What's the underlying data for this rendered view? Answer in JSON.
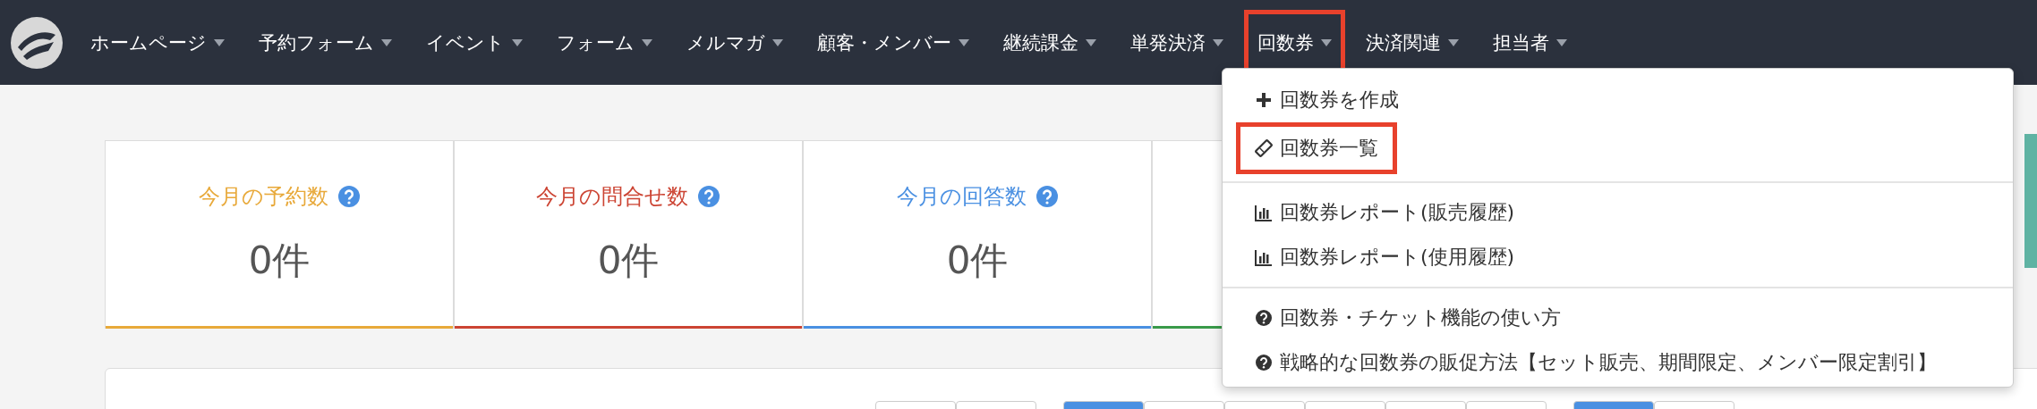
{
  "navbar": {
    "items": [
      {
        "label": "ホームページ",
        "highlighted": false
      },
      {
        "label": "予約フォーム",
        "highlighted": false
      },
      {
        "label": "イベント",
        "highlighted": false
      },
      {
        "label": "フォーム",
        "highlighted": false
      },
      {
        "label": "メルマガ",
        "highlighted": false
      },
      {
        "label": "顧客・メンバー",
        "highlighted": false
      },
      {
        "label": "継続課金",
        "highlighted": false
      },
      {
        "label": "単発決済",
        "highlighted": false
      },
      {
        "label": "回数券",
        "highlighted": true
      },
      {
        "label": "決済関連",
        "highlighted": false
      },
      {
        "label": "担当者",
        "highlighted": false
      }
    ]
  },
  "dropdown": {
    "groups": [
      [
        {
          "kind": "create",
          "label": "回数券を作成",
          "highlighted": false
        },
        {
          "kind": "list",
          "label": "回数券一覧",
          "highlighted": true
        }
      ],
      [
        {
          "kind": "report",
          "label": "回数券レポート(販売履歴)",
          "highlighted": false
        },
        {
          "kind": "report",
          "label": "回数券レポート(使用履歴)",
          "highlighted": false
        }
      ],
      [
        {
          "kind": "guide",
          "label": "回数券・チケット機能の使い方",
          "highlighted": false
        },
        {
          "kind": "guide",
          "label": "戦略的な回数券の販促方法【セット販売、期間限定、メンバー限定割引】",
          "highlighted": false
        }
      ]
    ]
  },
  "stats": [
    {
      "label": "今月の予約数",
      "value": "0件",
      "color": "#e8a93a"
    },
    {
      "label": "今月の問合せ数",
      "value": "0件",
      "color": "#cc4433"
    },
    {
      "label": "今月の回答数",
      "value": "0件",
      "color": "#4a90e2"
    },
    {
      "color": "#3a9a4a"
    }
  ],
  "range_groups": [
    [
      {
        "selected": false
      },
      {
        "selected": false
      }
    ],
    [
      {
        "selected": true
      },
      {
        "selected": false
      },
      {
        "selected": false
      },
      {
        "selected": false
      },
      {
        "selected": false
      },
      {
        "selected": false
      }
    ],
    [
      {
        "selected": true
      },
      {
        "selected": false
      }
    ]
  ]
}
